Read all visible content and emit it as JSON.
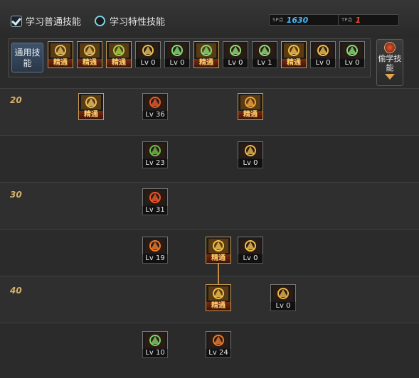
{
  "modes": {
    "normal_label": "学习普通技能",
    "trait_label": "学习特性技能"
  },
  "points": {
    "sp_label": "SP点",
    "sp_value": "1630",
    "tp_label": "TP点",
    "tp_value": "1",
    "sp_color": "#3fb6ff",
    "tp_color": "#e8492e"
  },
  "common": {
    "label": "通用技能",
    "skills": [
      {
        "name": "skill-meditate-icon",
        "caption": "精通",
        "gold": true
      },
      {
        "name": "skill-leap-icon",
        "caption": "精通",
        "gold": true
      },
      {
        "name": "skill-kick-icon",
        "caption": "精通",
        "gold": true
      },
      {
        "name": "skill-phoenix-icon",
        "caption": "Lv 0",
        "gold": false
      },
      {
        "name": "skill-target-icon",
        "caption": "Lv 0",
        "gold": false
      },
      {
        "name": "skill-aim-icon",
        "caption": "精通",
        "gold": true
      },
      {
        "name": "skill-warrior-icon",
        "caption": "Lv 0",
        "gold": false
      },
      {
        "name": "skill-rider-icon",
        "caption": "Lv 1",
        "gold": false
      },
      {
        "name": "skill-ring-icon",
        "caption": "精通",
        "gold": true
      },
      {
        "name": "skill-golden-figure-icon",
        "caption": "Lv 0",
        "gold": false
      },
      {
        "name": "skill-sprint-icon",
        "caption": "Lv 0",
        "gold": false
      }
    ]
  },
  "steal": {
    "label": "偷学技能"
  },
  "tree": {
    "levels": [
      "20",
      "30",
      "40"
    ],
    "skills": [
      {
        "name": "tree-skill-claw-icon",
        "caption": "精通",
        "gold": true
      },
      {
        "name": "tree-skill-flame-eye-icon",
        "caption": "Lv 36",
        "gold": false
      },
      {
        "name": "tree-skill-fire-burst-icon",
        "caption": "精通",
        "gold": true
      },
      {
        "name": "tree-skill-green-dagger-icon",
        "caption": "Lv 23",
        "gold": false
      },
      {
        "name": "tree-skill-golden-drill-icon",
        "caption": "Lv 0",
        "gold": false
      },
      {
        "name": "tree-skill-fire-spear-icon",
        "caption": "Lv 31",
        "gold": false
      },
      {
        "name": "tree-skill-fire-beast-icon",
        "caption": "Lv 19",
        "gold": false
      },
      {
        "name": "tree-skill-golden-storm-icon",
        "caption": "精通",
        "gold": true
      },
      {
        "name": "tree-skill-golden-fist-icon",
        "caption": "Lv 0",
        "gold": false
      },
      {
        "name": "tree-skill-golden-orb-icon",
        "caption": "精通",
        "gold": true
      },
      {
        "name": "tree-skill-golden-dragon-icon",
        "caption": "Lv 0",
        "gold": false
      },
      {
        "name": "tree-skill-green-rune-icon",
        "caption": "Lv 10",
        "gold": false
      },
      {
        "name": "tree-skill-flame-blast-icon",
        "caption": "Lv 24",
        "gold": false
      }
    ]
  }
}
